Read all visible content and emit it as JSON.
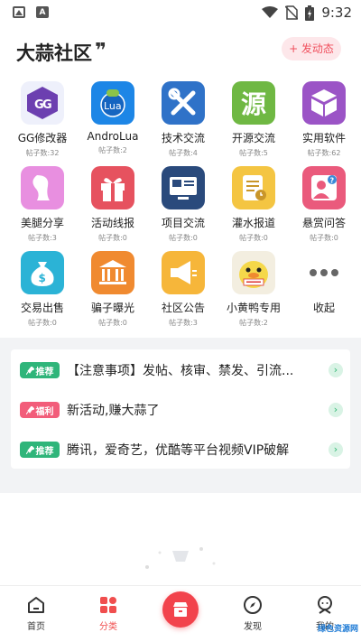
{
  "status_bar": {
    "time": "9:32"
  },
  "header": {
    "title": "大蒜社区",
    "post_button": "+ 发动态"
  },
  "categories": [
    {
      "name": "GG修改器",
      "count": "帖子数:32",
      "icon": "gg-modifier-icon",
      "color": "#eef0fb"
    },
    {
      "name": "AndroLua",
      "count": "帖子数:2",
      "icon": "androlua-icon",
      "color": "#1d86e6"
    },
    {
      "name": "技术交流",
      "count": "帖子数:4",
      "icon": "tools-icon",
      "color": "#2f72c8"
    },
    {
      "name": "开源交流",
      "count": "帖子数:5",
      "icon": "source-icon",
      "color": "#6fb843"
    },
    {
      "name": "实用软件",
      "count": "帖子数:62",
      "icon": "box-icon",
      "color": "#9b54c6"
    },
    {
      "name": "美腿分享",
      "count": "帖子数:3",
      "icon": "legs-icon",
      "color": "#e88fe0"
    },
    {
      "name": "活动线报",
      "count": "帖子数:0",
      "icon": "gift-icon",
      "color": "#e6525f"
    },
    {
      "name": "项目交流",
      "count": "帖子数:0",
      "icon": "monitor-icon",
      "color": "#2a4a7c"
    },
    {
      "name": "灌水报道",
      "count": "帖子数:0",
      "icon": "notepad-icon",
      "color": "#f4c542"
    },
    {
      "name": "悬赏问答",
      "count": "帖子数:0",
      "icon": "question-person-icon",
      "color": "#ea5a7c"
    },
    {
      "name": "交易出售",
      "count": "帖子数:0",
      "icon": "money-bag-icon",
      "color": "#2bb3d6"
    },
    {
      "name": "骗子曝光",
      "count": "帖子数:0",
      "icon": "bank-icon",
      "color": "#f08a30"
    },
    {
      "name": "社区公告",
      "count": "帖子数:3",
      "icon": "megaphone-icon",
      "color": "#f6b63a"
    },
    {
      "name": "小黄鸭专用",
      "count": "帖子数:2",
      "icon": "yellow-duck-icon",
      "color": "#f3eee0"
    },
    {
      "name": "收起",
      "count": "",
      "icon": "more-dots-icon",
      "color": "#ffffff"
    }
  ],
  "announcements": [
    {
      "tag": "推荐",
      "tag_color": "#2fb57a",
      "text": "【注意事项】发帖、核审、禁发、引流..."
    },
    {
      "tag": "福利",
      "tag_color": "#f25d7a",
      "text": "新活动,赚大蒜了"
    },
    {
      "tag": "推荐",
      "tag_color": "#2fb57a",
      "text": "腾讯，爱奇艺，优酷等平台视频VIP破解"
    }
  ],
  "tabs": [
    {
      "label": "首页",
      "icon": "home-icon"
    },
    {
      "label": "分类",
      "icon": "category-icon"
    },
    {
      "label": "发现",
      "icon": "compass-icon"
    },
    {
      "label": "我的",
      "icon": "profile-icon"
    }
  ],
  "watermark": "绿色资源网",
  "accent": "#f04e4e"
}
